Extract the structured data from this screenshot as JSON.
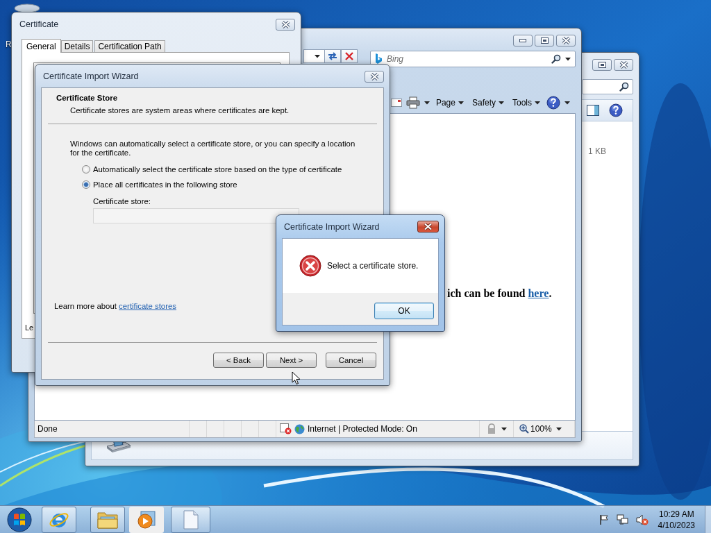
{
  "desktop": {
    "icon_label": "R"
  },
  "explorer_window": {
    "size_text": "1 KB"
  },
  "browser": {
    "search": {
      "placeholder": "Bing"
    },
    "command_bar": [
      {
        "label": "Page"
      },
      {
        "label": "Safety"
      },
      {
        "label": "Tools"
      }
    ],
    "content": {
      "text": "ich can be found ",
      "link": "here",
      "tail": "."
    },
    "status_bar": {
      "status": "Done",
      "zone": "Internet | Protected Mode: On",
      "zoom": "100%"
    }
  },
  "certificate_window": {
    "title": "Certificate",
    "tabs": [
      {
        "label": "General",
        "selected": true
      },
      {
        "label": "Details",
        "selected": false
      },
      {
        "label": "Certification Path",
        "selected": false
      }
    ],
    "cut_text": "Le"
  },
  "wizard": {
    "title": "Certificate Import Wizard",
    "heading": "Certificate Store",
    "subheading": "Certificate stores are system areas where certificates are kept.",
    "intro": "Windows can automatically select a certificate store, or you can specify a location for the certificate.",
    "options": [
      {
        "label": "Automatically select the certificate store based on the type of certificate",
        "selected": false
      },
      {
        "label": "Place all certificates in the following store",
        "selected": true
      }
    ],
    "store_label": "Certificate store:",
    "store_field": {
      "disabled": true
    },
    "learn_more": {
      "text": "Learn more about ",
      "link": "certificate stores"
    },
    "buttons": [
      {
        "label": "< Back"
      },
      {
        "label": "Next >"
      },
      {
        "label": "Cancel"
      }
    ]
  },
  "error_dialog": {
    "title": "Certificate Import Wizard",
    "message": "Select a certificate store.",
    "button": "OK"
  },
  "taskbar": {
    "time": "10:29 AM",
    "date": "4/10/2023"
  }
}
